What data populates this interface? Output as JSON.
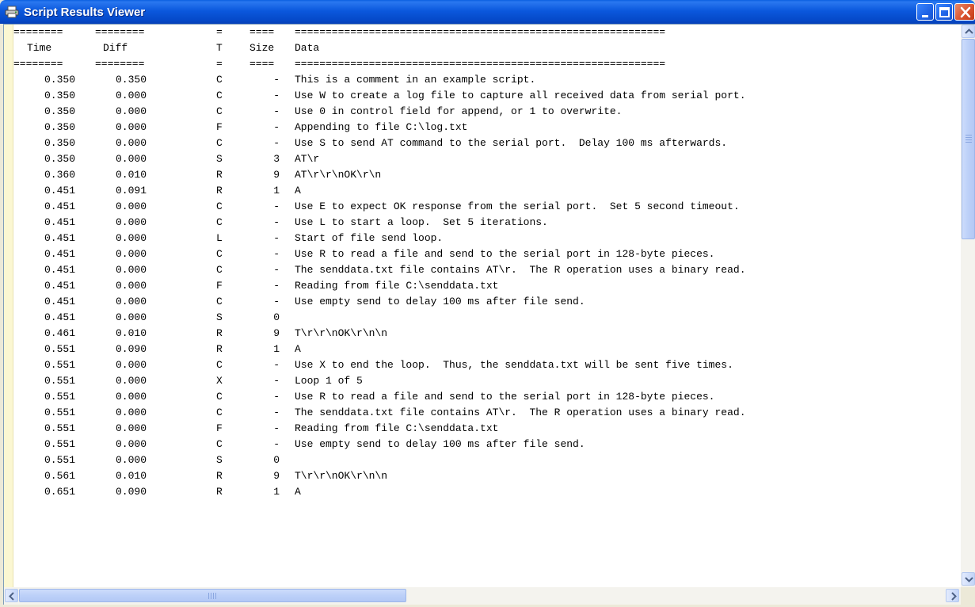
{
  "window": {
    "title": "Script Results Viewer",
    "icon": "printer-window-icon"
  },
  "header": {
    "rule_time": "========",
    "rule_diff": "========",
    "rule_t": "=",
    "rule_size": "====",
    "rule_data": "============================================================",
    "col_time": "Time",
    "col_diff": "Diff",
    "col_t": "T",
    "col_size": "Size",
    "col_data": "Data"
  },
  "rows": [
    {
      "time": "0.350",
      "diff": "0.350",
      "t": "C",
      "size": "-",
      "data": "This is a comment in an example script."
    },
    {
      "time": "0.350",
      "diff": "0.000",
      "t": "C",
      "size": "-",
      "data": "Use W to create a log file to capture all received data from serial port."
    },
    {
      "time": "0.350",
      "diff": "0.000",
      "t": "C",
      "size": "-",
      "data": "Use 0 in control field for append, or 1 to overwrite."
    },
    {
      "time": "0.350",
      "diff": "0.000",
      "t": "F",
      "size": "-",
      "data": "Appending to file C:\\log.txt"
    },
    {
      "time": "0.350",
      "diff": "0.000",
      "t": "C",
      "size": "-",
      "data": "Use S to send AT command to the serial port.  Delay 100 ms afterwards."
    },
    {
      "time": "0.350",
      "diff": "0.000",
      "t": "S",
      "size": "3",
      "data": "AT\\r"
    },
    {
      "time": "0.360",
      "diff": "0.010",
      "t": "R",
      "size": "9",
      "data": "AT\\r\\r\\nOK\\r\\n"
    },
    {
      "time": "0.451",
      "diff": "0.091",
      "t": "R",
      "size": "1",
      "data": "A"
    },
    {
      "time": "0.451",
      "diff": "0.000",
      "t": "C",
      "size": "-",
      "data": "Use E to expect OK response from the serial port.  Set 5 second timeout."
    },
    {
      "time": "0.451",
      "diff": "0.000",
      "t": "C",
      "size": "-",
      "data": "Use L to start a loop.  Set 5 iterations."
    },
    {
      "time": "0.451",
      "diff": "0.000",
      "t": "L",
      "size": "-",
      "data": "Start of file send loop."
    },
    {
      "time": "0.451",
      "diff": "0.000",
      "t": "C",
      "size": "-",
      "data": "Use R to read a file and send to the serial port in 128-byte pieces."
    },
    {
      "time": "0.451",
      "diff": "0.000",
      "t": "C",
      "size": "-",
      "data": "The senddata.txt file contains AT\\r.  The R operation uses a binary read."
    },
    {
      "time": "0.451",
      "diff": "0.000",
      "t": "F",
      "size": "-",
      "data": "Reading from file C:\\senddata.txt"
    },
    {
      "time": "0.451",
      "diff": "0.000",
      "t": "C",
      "size": "-",
      "data": "Use empty send to delay 100 ms after file send."
    },
    {
      "time": "0.451",
      "diff": "0.000",
      "t": "S",
      "size": "0",
      "data": ""
    },
    {
      "time": "0.461",
      "diff": "0.010",
      "t": "R",
      "size": "9",
      "data": "T\\r\\r\\nOK\\r\\n\\n"
    },
    {
      "time": "0.551",
      "diff": "0.090",
      "t": "R",
      "size": "1",
      "data": "A"
    },
    {
      "time": "0.551",
      "diff": "0.000",
      "t": "C",
      "size": "-",
      "data": "Use X to end the loop.  Thus, the senddata.txt will be sent five times."
    },
    {
      "time": "0.551",
      "diff": "0.000",
      "t": "X",
      "size": "-",
      "data": "Loop 1 of 5"
    },
    {
      "time": "0.551",
      "diff": "0.000",
      "t": "C",
      "size": "-",
      "data": "Use R to read a file and send to the serial port in 128-byte pieces."
    },
    {
      "time": "0.551",
      "diff": "0.000",
      "t": "C",
      "size": "-",
      "data": "The senddata.txt file contains AT\\r.  The R operation uses a binary read."
    },
    {
      "time": "0.551",
      "diff": "0.000",
      "t": "F",
      "size": "-",
      "data": "Reading from file C:\\senddata.txt"
    },
    {
      "time": "0.551",
      "diff": "0.000",
      "t": "C",
      "size": "-",
      "data": "Use empty send to delay 100 ms after file send."
    },
    {
      "time": "0.551",
      "diff": "0.000",
      "t": "S",
      "size": "0",
      "data": ""
    },
    {
      "time": "0.561",
      "diff": "0.010",
      "t": "R",
      "size": "9",
      "data": "T\\r\\r\\nOK\\r\\n\\n"
    },
    {
      "time": "0.651",
      "diff": "0.090",
      "t": "R",
      "size": "1",
      "data": "A"
    }
  ],
  "scrollbars": {
    "vertical_position": 0.0,
    "horizontal_position": 0.0
  }
}
